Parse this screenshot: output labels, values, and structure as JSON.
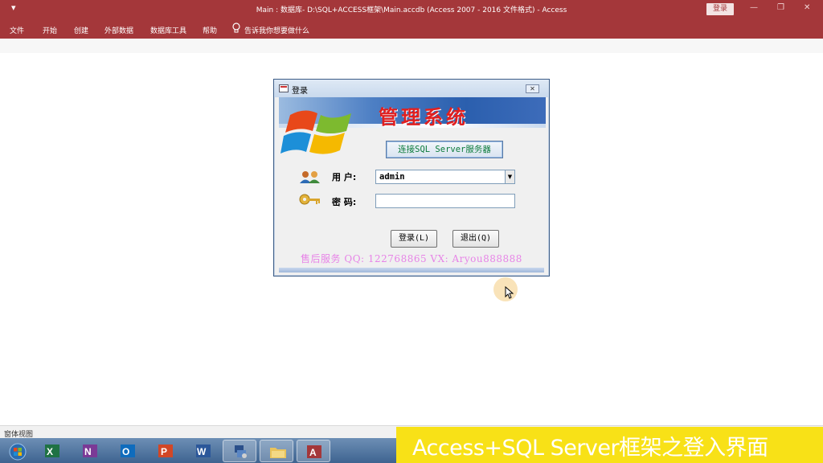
{
  "window": {
    "qat_icon": "customize-qat-icon",
    "title": "Main : 数据库- D:\\SQL+ACCESS框架\\Main.accdb (Access 2007 - 2016 文件格式)  -  Access",
    "sign_in_label": "登录",
    "controls": {
      "minimize": "—",
      "restore": "❐",
      "close": "✕"
    }
  },
  "ribbon": {
    "tabs": [
      "文件",
      "开始",
      "创建",
      "外部数据",
      "数据库工具",
      "帮助"
    ],
    "tell_me": "告诉我你想要做什么"
  },
  "dialog": {
    "caption": "登录",
    "close_glyph": "✕",
    "system_title": "管理系统",
    "connect_button": "连接SQL Server服务器",
    "user_label": "用  户:",
    "user_value": "admin",
    "password_label": "密  码:",
    "password_value": "",
    "login_button": "登录(L)",
    "exit_button": "退出(Q)",
    "service_line": "售后服务 QQ: 122768865 VX: Aryou888888"
  },
  "statusbar": {
    "text": "窗体视图"
  },
  "taskbar": {
    "items": [
      "windows-start-icon",
      "excel-icon",
      "onenote-icon",
      "outlook-icon",
      "powerpoint-icon",
      "word-icon",
      "network-icon",
      "file-explorer-icon",
      "access-icon"
    ]
  },
  "caption_banner": "Access+SQL Server框架之登入界面",
  "colors": {
    "access_red": "#a4373a",
    "banner_yellow": "#f8e117",
    "title_red": "#e02020",
    "service_pink": "#e784e7"
  }
}
